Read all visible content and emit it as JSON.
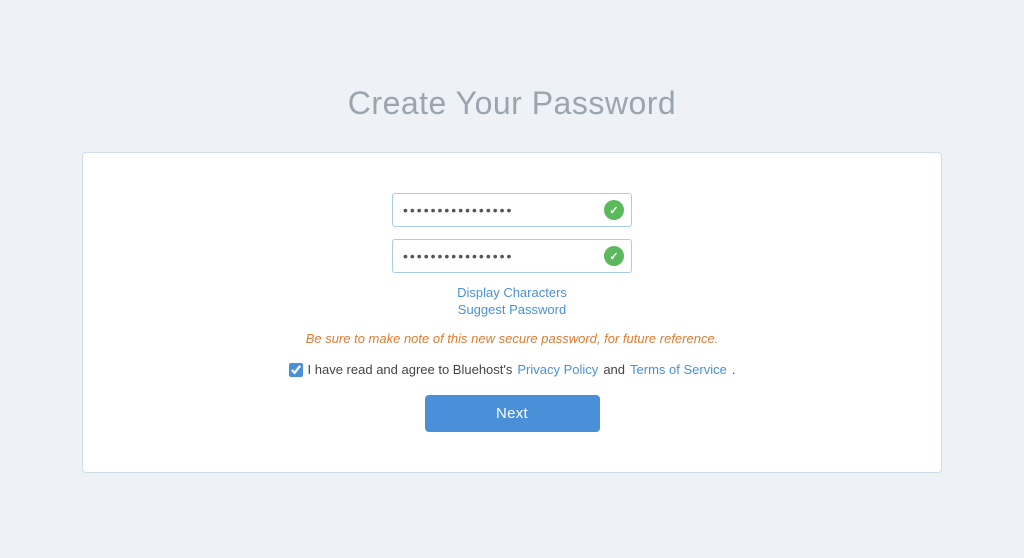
{
  "page": {
    "title": "Create Your Password",
    "background_color": "#eef1f5"
  },
  "form": {
    "password_field_1": {
      "value": "●●●●●●●●●●●●●●●●",
      "placeholder": ""
    },
    "password_field_2": {
      "value": "●●●●●●●●●●●●●●●●",
      "placeholder": ""
    },
    "display_characters_label": "Display Characters",
    "suggest_password_label": "Suggest Password",
    "warning_text": "Be sure to make note of this new secure password, for future reference.",
    "agreement_prefix": "I have read and agree to Bluehost's",
    "privacy_policy_label": "Privacy Policy",
    "agreement_and": "and",
    "terms_label": "Terms of Service",
    "agreement_suffix": ".",
    "next_button_label": "Next"
  }
}
